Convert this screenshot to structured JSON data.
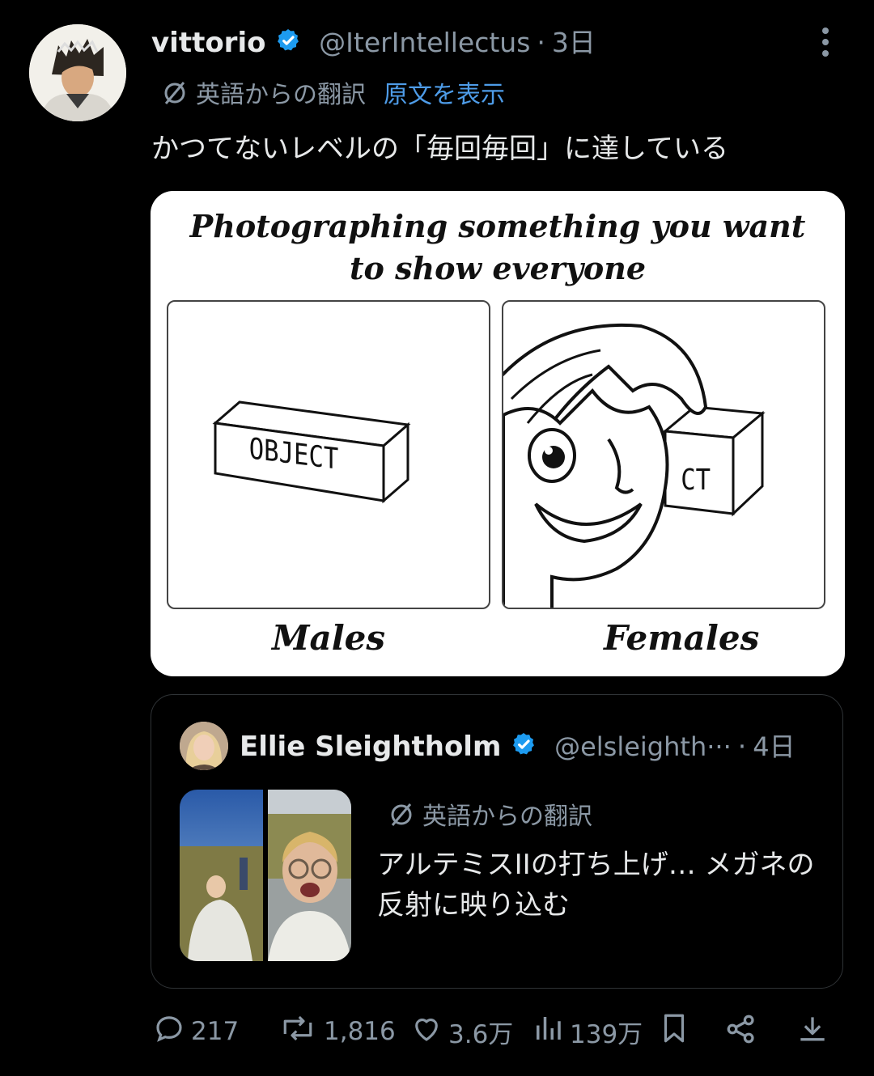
{
  "post": {
    "author_name": "vittorio",
    "author_handle": "@IterIntellectus",
    "separator": "·",
    "time": "3日",
    "translation_label": "英語からの翻訳",
    "show_original": "原文を表示",
    "text": "かつてないレベルの「毎回毎回」に達している"
  },
  "comic": {
    "title_line1": "Photographing something you want",
    "title_line2": "to show everyone",
    "box_label": "OBJECT",
    "box_label_partial": "CT",
    "caption_left": "Males",
    "caption_right": "Females"
  },
  "quoted": {
    "author_name": "Ellie Sleightholm",
    "author_handle": "@elsleighth···",
    "separator": "·",
    "time": "4日",
    "translation_label": "英語からの翻訳",
    "text": "アルテミスIIの打ち上げ… メガネの反射に映り込む"
  },
  "actions": {
    "replies": "217",
    "reposts": "1,816",
    "likes": "3.6万",
    "views": "139万"
  },
  "colors": {
    "background": "#000000",
    "text": "#e7e9ea",
    "muted": "#8b98a5",
    "link": "#4e9ce8",
    "verified": "#1d9bf0"
  },
  "icons": [
    "more-icon",
    "translate-icon",
    "verified-icon",
    "reply-icon",
    "repost-icon",
    "like-icon",
    "views-icon",
    "bookmark-icon",
    "share-icon",
    "download-icon"
  ]
}
